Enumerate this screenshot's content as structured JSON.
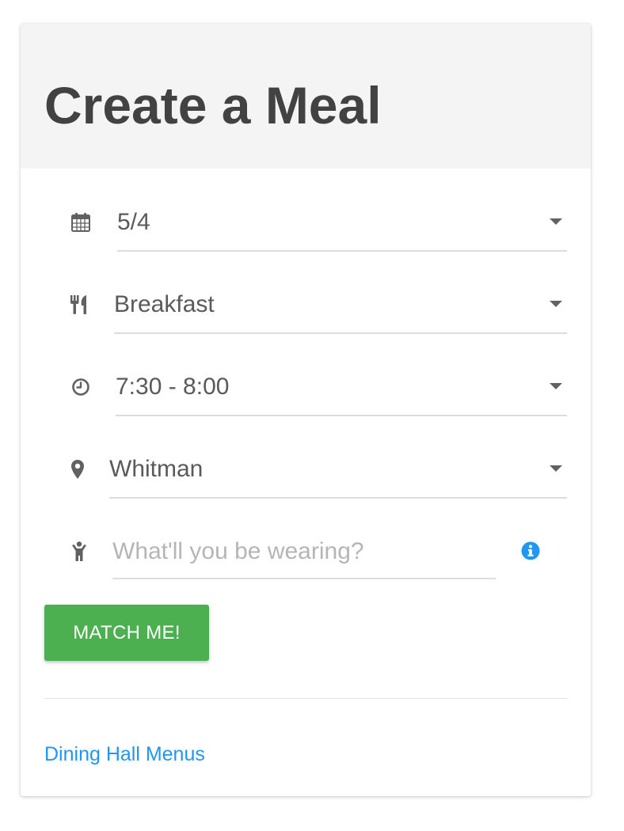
{
  "header": {
    "title": "Create a Meal"
  },
  "form": {
    "date": {
      "value": "5/4",
      "icon": "calendar-icon"
    },
    "meal": {
      "value": "Breakfast",
      "icon": "utensils-icon"
    },
    "time": {
      "value": "7:30 - 8:00",
      "icon": "clock-icon"
    },
    "location": {
      "value": "Whitman",
      "icon": "map-marker-icon"
    },
    "wearing": {
      "value": "",
      "placeholder": "What'll you be wearing?",
      "icon": "person-icon",
      "help_icon": "info-icon"
    }
  },
  "actions": {
    "match_label": "MATCH ME!"
  },
  "footer": {
    "menus_link": "Dining Hall Menus"
  },
  "colors": {
    "header_bg": "#f4f4f4",
    "title": "#424242",
    "button": "#4caf50",
    "link": "#2196f3",
    "info": "#2196f3",
    "icon": "#616161"
  }
}
